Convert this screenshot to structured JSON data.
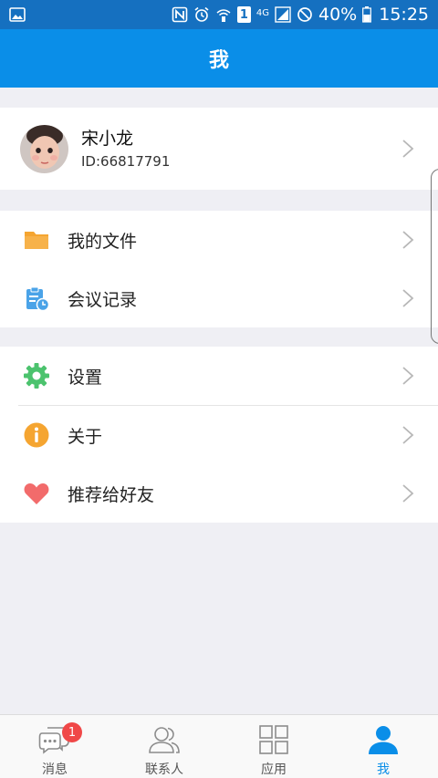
{
  "status_bar": {
    "battery_percent": "40%",
    "time": "15:25",
    "network_label": "4G",
    "sim_label": "1"
  },
  "header": {
    "title": "我"
  },
  "profile": {
    "name": "宋小龙",
    "id_text": "ID:66817791"
  },
  "menu": {
    "my_files": {
      "label": "我的文件",
      "icon": "folder-icon",
      "color": "#f5a531"
    },
    "meeting_records": {
      "label": "会议记录",
      "icon": "clipboard-clock-icon",
      "color": "#4aa3e8"
    },
    "settings": {
      "label": "设置",
      "icon": "gear-icon",
      "color": "#4cc36e"
    },
    "about": {
      "label": "关于",
      "icon": "info-icon",
      "color": "#f5a531"
    },
    "recommend": {
      "label": "推荐给好友",
      "icon": "heart-icon",
      "color": "#f26b6b"
    }
  },
  "tabs": [
    {
      "label": "消息",
      "icon": "chat-icon",
      "badge": "1"
    },
    {
      "label": "联系人",
      "icon": "contacts-icon"
    },
    {
      "label": "应用",
      "icon": "apps-grid-icon"
    },
    {
      "label": "我",
      "icon": "user-icon",
      "active": true
    }
  ],
  "colors": {
    "header_bg": "#0a8ee8",
    "status_bg": "#1570c0",
    "active_tab": "#0a8ee8",
    "badge": "#f04848"
  }
}
